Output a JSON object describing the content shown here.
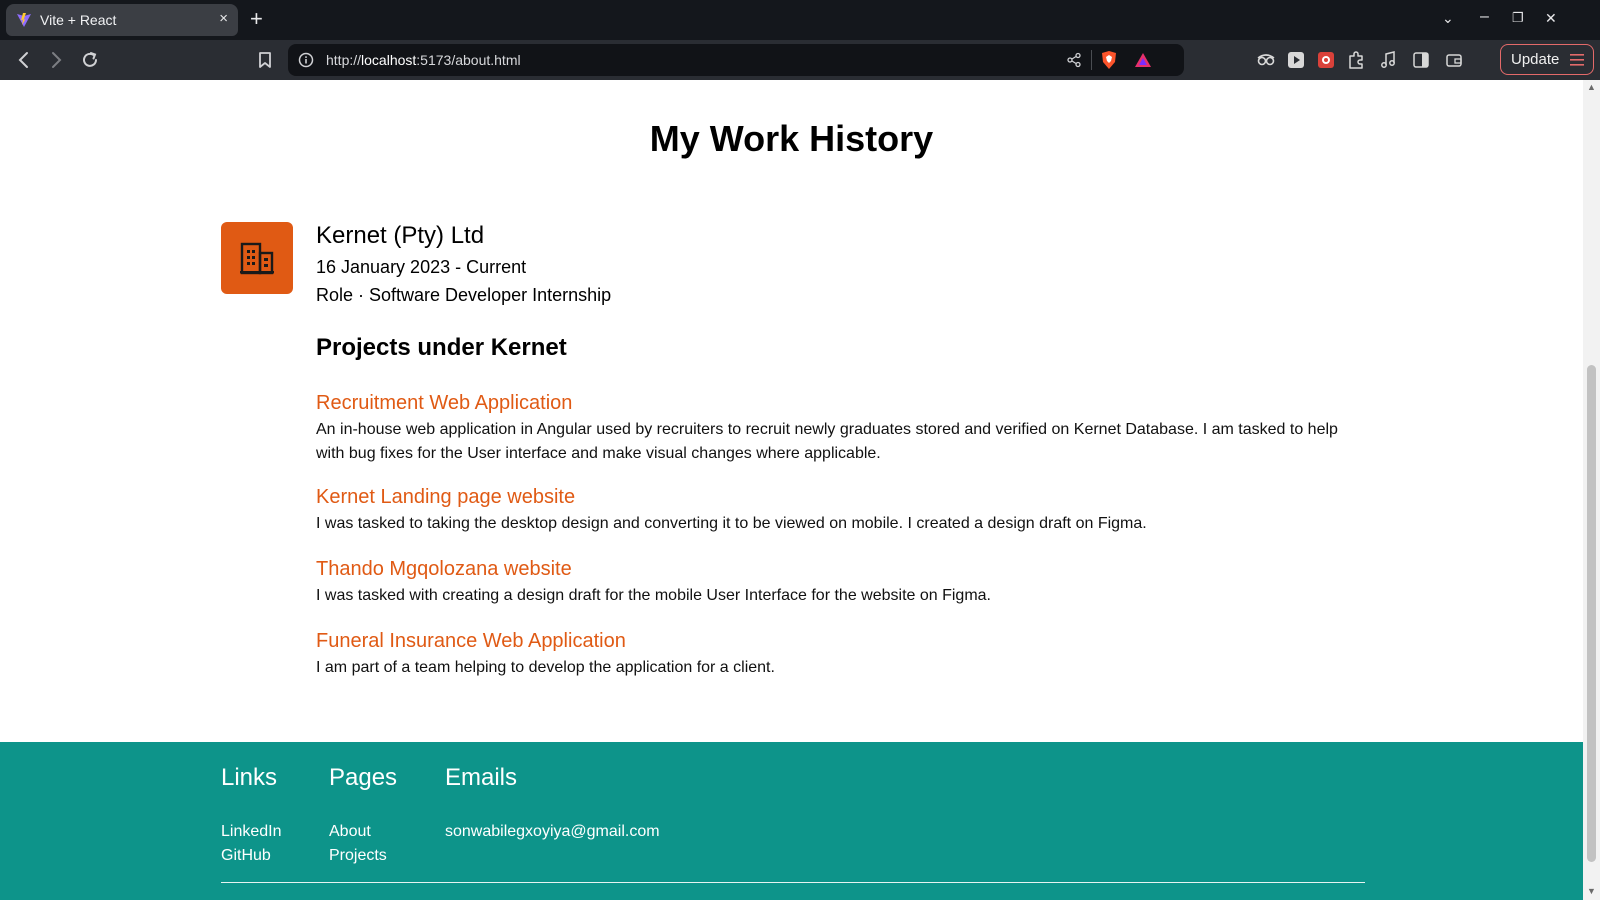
{
  "browser": {
    "tab_title": "Vite + React",
    "tab_close": "×",
    "new_tab": "+",
    "url_prefix": "http://",
    "url_host": "localhost",
    "url_rest": ":5173/about.html",
    "update_label": "Update",
    "minimize": "–",
    "restore": "❐",
    "close": "✕",
    "tab_list": "⌄"
  },
  "main": {
    "page_title": "My Work History",
    "company": {
      "name": "Kernet (Pty) Ltd",
      "dates": "16 January 2023 - Current",
      "role": "Role · Software Developer Internship"
    },
    "projects_heading": "Projects under Kernet",
    "projects": [
      {
        "title": "Recruitment Web Application",
        "description": "An in-house web application in Angular used by recruiters to recruit newly graduates stored and verified on Kernet Database. I am tasked to help with bug fixes for the User interface and make visual changes where applicable."
      },
      {
        "title": "Kernet Landing page website",
        "description": "I was tasked to taking the desktop design and converting it to be viewed on mobile. I created a design draft on Figma."
      },
      {
        "title": "Thando Mgqolozana website",
        "description": "I was tasked with creating a design draft for the mobile User Interface for the website on Figma."
      },
      {
        "title": "Funeral Insurance Web Application",
        "description": "I am part of a team helping to develop the application for a client."
      }
    ]
  },
  "footer": {
    "links": {
      "heading": "Links",
      "items": [
        "LinkedIn",
        "GitHub"
      ]
    },
    "pages": {
      "heading": "Pages",
      "items": [
        "About",
        "Projects"
      ]
    },
    "emails": {
      "heading": "Emails",
      "items": [
        "sonwabilegxoyiya@gmail.com"
      ]
    }
  },
  "colors": {
    "accent": "#e05a14",
    "footer_bg": "#0d948a",
    "chrome_dark": "#14171c",
    "toolbar": "#2a2d33"
  },
  "icons": {
    "tab_favicon": "vite-logo-icon",
    "company_logo": "building-icon"
  }
}
